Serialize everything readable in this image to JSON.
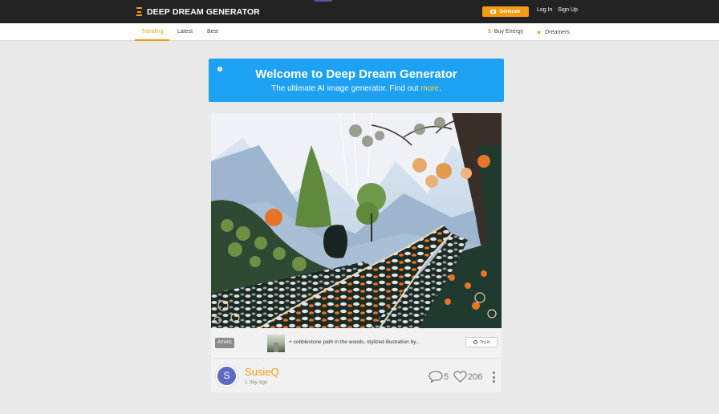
{
  "header": {
    "logo_text": "DEEP DREAM GENERATOR",
    "generate_label": "Generate",
    "login_label": "Log In",
    "signup_label": "Sign Up",
    "accent_color": "#f39c12"
  },
  "subnav": {
    "tabs": [
      {
        "label": "Trending",
        "active": true
      },
      {
        "label": "Latest",
        "active": false
      },
      {
        "label": "Best",
        "active": false
      }
    ],
    "buy_energy_label": "Buy Energy",
    "dreamers_label": "Dreamers"
  },
  "banner": {
    "title": "Welcome to Deep Dream Generator",
    "subtitle": "The ultimate AI image generator. Find out",
    "link_text": "more",
    "suffix": ".",
    "color": "#1da1f2"
  },
  "post": {
    "image_description_icon": "artwork-image",
    "style_badge": "Artistic",
    "prompt_prefix": "+",
    "prompt": "cobblestone path in the woods, stylized illustration by...",
    "try_it_label": "Try it",
    "author": {
      "initial": "S",
      "name": "SusieQ",
      "time": "1 day ago",
      "avatar_color": "#5c6bc0"
    },
    "comments": "5",
    "likes": "206"
  }
}
